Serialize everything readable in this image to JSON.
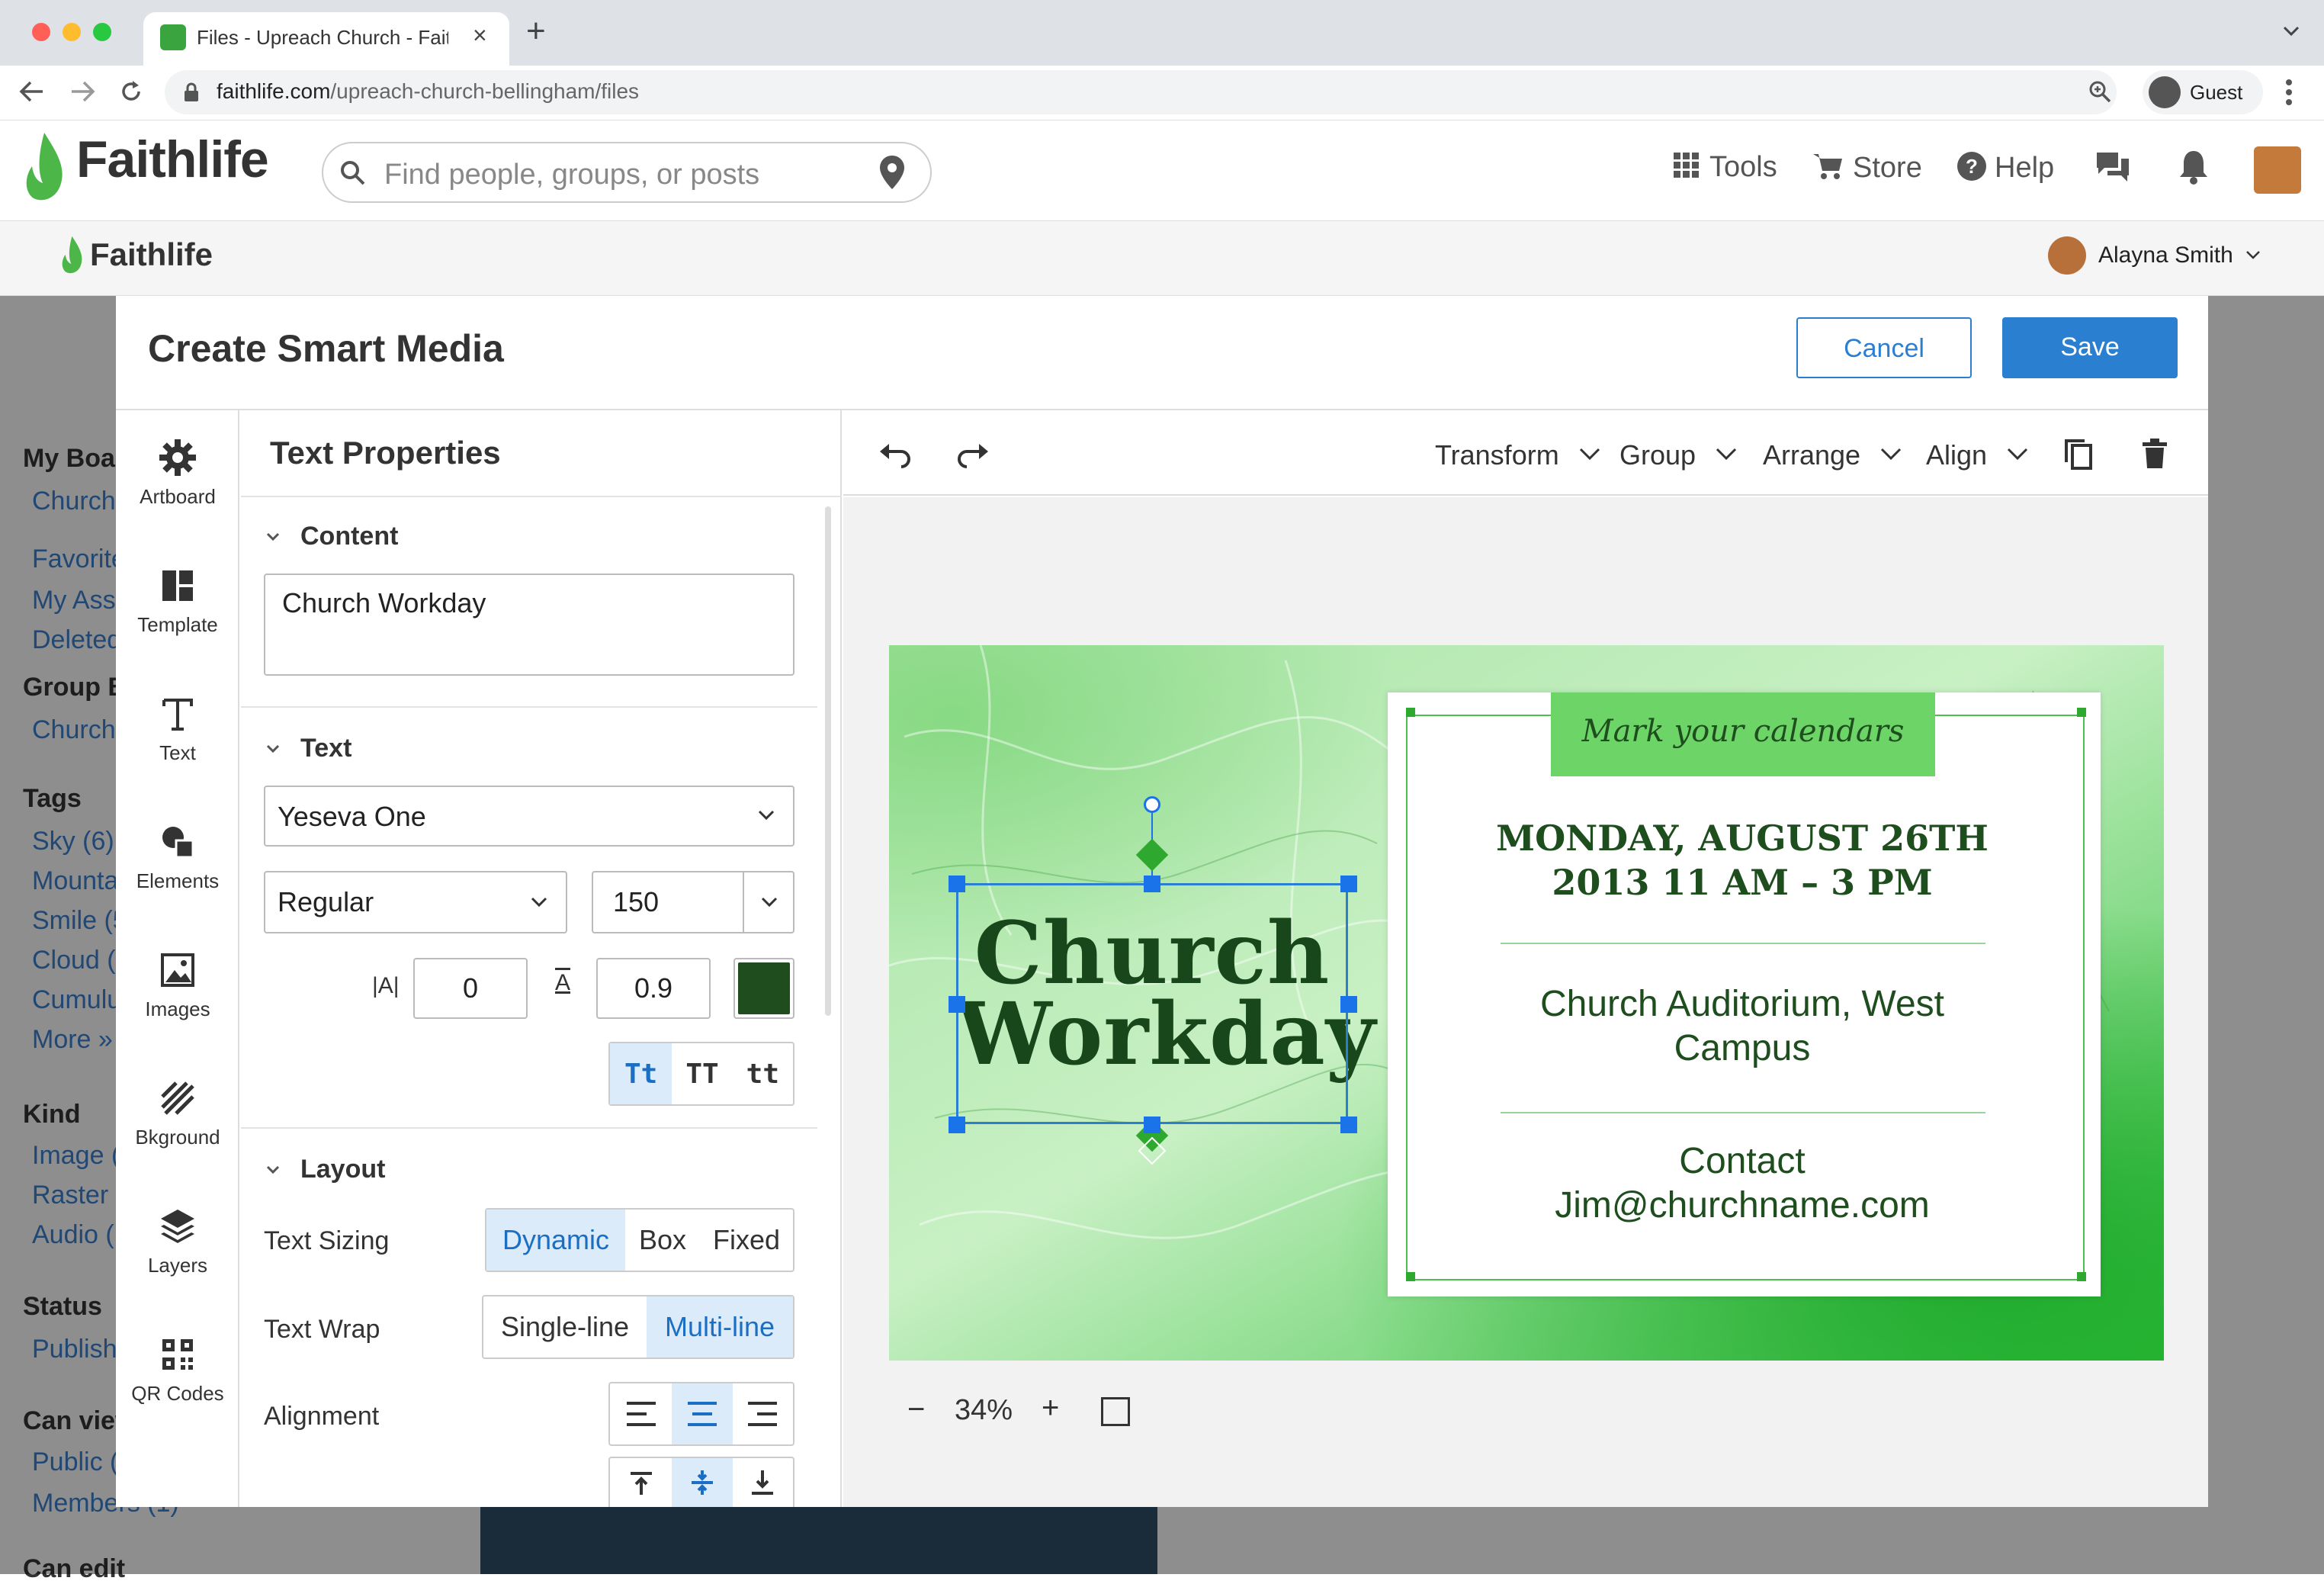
{
  "browser": {
    "tab_title": "Files - Upreach Church - Faithl",
    "url_domain": "faithlife.com",
    "url_path": "/upreach-church-bellingham/files",
    "profile_label": "Guest"
  },
  "header": {
    "logo": "Faithlife",
    "search_placeholder": "Find people, groups, or posts",
    "nav": {
      "tools": "Tools",
      "store": "Store",
      "help": "Help"
    },
    "sub_logo": "Faithlife",
    "user_name": "Alayna Smith"
  },
  "background_page": {
    "sections": [
      {
        "heading": "My Boar",
        "items": [
          "Church"
        ]
      },
      {
        "heading": "",
        "items": [
          "Favorite",
          "My Asse",
          "Deleted"
        ]
      },
      {
        "heading": "Group B",
        "items": [
          "Church"
        ]
      },
      {
        "heading": "Tags",
        "items": [
          "Sky (6)",
          "Mounta",
          "Smile (5",
          "Cloud (4",
          "Cumulu",
          "More »"
        ]
      },
      {
        "heading": "Kind",
        "items": [
          "Image (",
          "Raster (",
          "Audio ("
        ]
      },
      {
        "heading": "Status",
        "items": [
          "Publish"
        ]
      },
      {
        "heading": "Can view",
        "items": [
          "Public (",
          "Members (1)"
        ]
      },
      {
        "heading": "Can edit",
        "items": []
      }
    ]
  },
  "modal": {
    "title": "Create Smart Media",
    "cancel_label": "Cancel",
    "save_label": "Save"
  },
  "rail": [
    "Artboard",
    "Template",
    "Text",
    "Elements",
    "Images",
    "Bkground",
    "Layers",
    "QR Codes"
  ],
  "props": {
    "title": "Text Properties",
    "content_section": "Content",
    "content_value": "Church Workday",
    "text_section": "Text",
    "font_family": "Yeseva One",
    "font_weight": "Regular",
    "font_size": "150",
    "letter_spacing": "0",
    "line_height": "0.9",
    "text_color": "#1f4d1d",
    "case_options": [
      "Tt",
      "TT",
      "tt"
    ],
    "case_selected": "Tt",
    "layout_section": "Layout",
    "text_sizing_label": "Text Sizing",
    "text_sizing_options": [
      "Dynamic",
      "Box",
      "Fixed"
    ],
    "text_sizing_selected": "Dynamic",
    "text_wrap_label": "Text Wrap",
    "text_wrap_options": [
      "Single-line",
      "Multi-line"
    ],
    "text_wrap_selected": "Multi-line",
    "alignment_label": "Alignment",
    "alignment_selected": "center"
  },
  "toolbar": {
    "transform": "Transform",
    "group": "Group",
    "arrange": "Arrange",
    "align": "Align"
  },
  "artboard": {
    "headline_line1": "Church",
    "headline_line2": "Workday",
    "ribbon_text": "Mark your calendars",
    "date_line1": "MONDAY, AUGUST 26TH",
    "date_line2": "2013 11 AM – 3 PM",
    "place_line1": "Church Auditorium, West",
    "place_line2": "Campus",
    "contact_line1": "Contact",
    "contact_line2": "Jim@churchname.com",
    "accent_color": "#6dd468"
  },
  "zoom": {
    "minus": "−",
    "value": "34%",
    "plus": "+"
  }
}
